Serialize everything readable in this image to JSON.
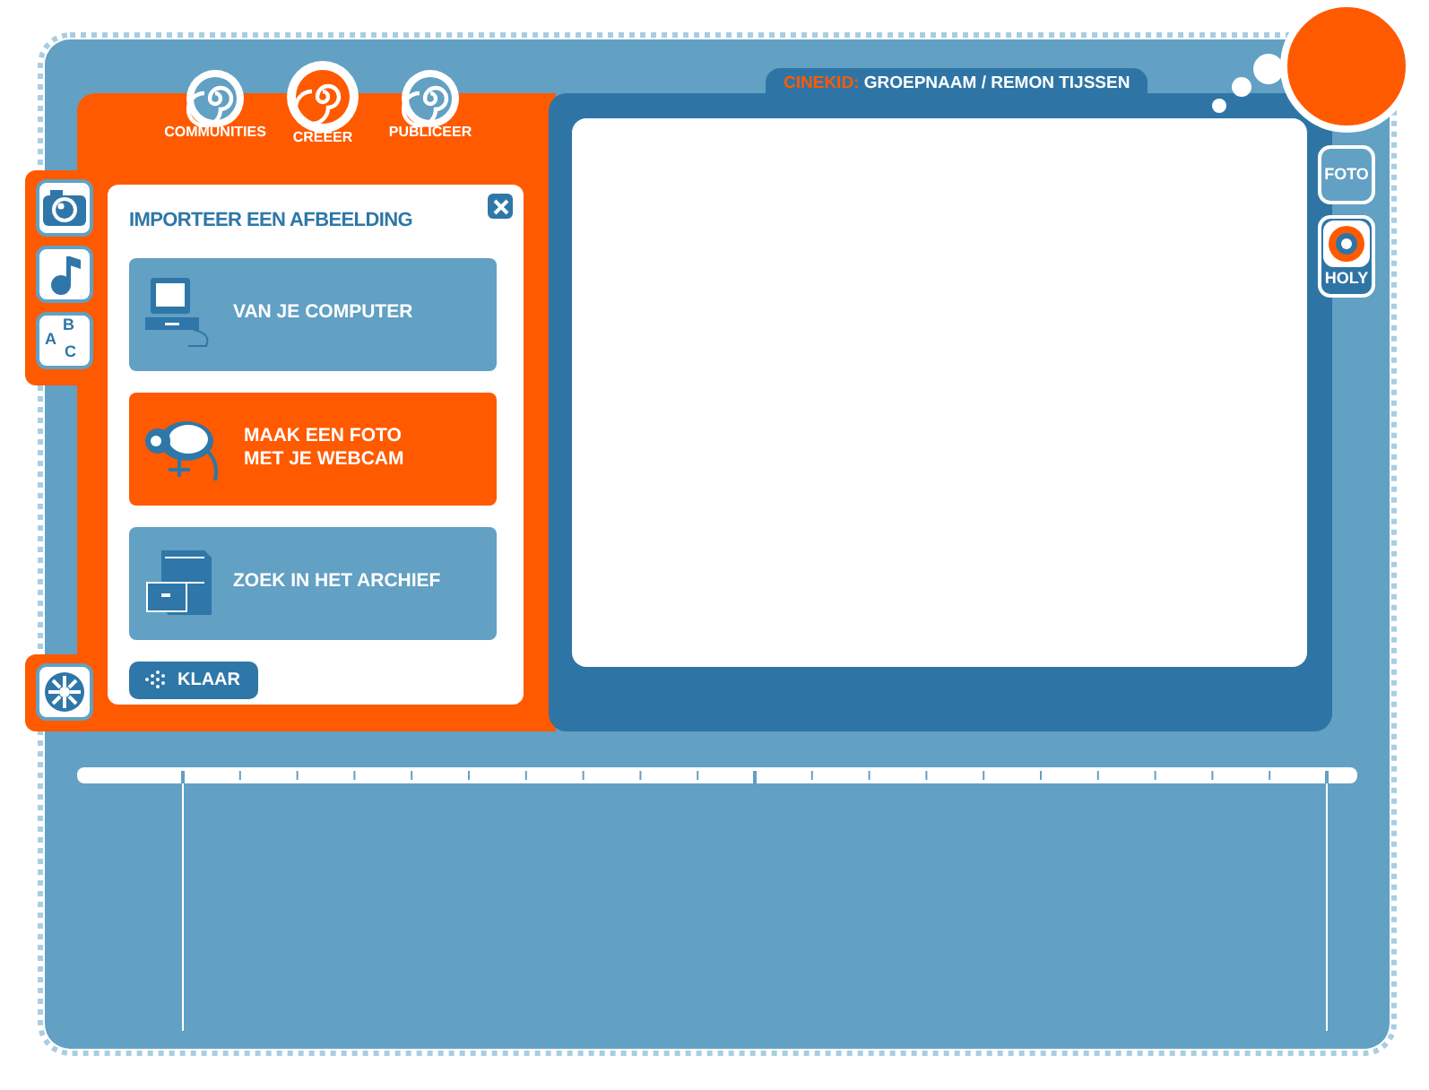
{
  "nav_tabs": [
    {
      "label": "COMMUNITIES",
      "selected": false
    },
    {
      "label": "CREËER",
      "selected": true
    },
    {
      "label": "PUBLICEER",
      "selected": false
    }
  ],
  "tool_tabs": [
    {
      "kind": "camera"
    },
    {
      "kind": "music"
    },
    {
      "kind": "letters",
      "letters": [
        "B",
        "A",
        "C"
      ]
    }
  ],
  "dialog": {
    "title": "IMPORTEER EEN AFBEELDING",
    "options": [
      {
        "kind": "computer",
        "label": "VAN JE COMPUTER",
        "selected": false
      },
      {
        "kind": "webcam",
        "label": "MAAK EEN FOTO\nMET JE WEBCAM",
        "selected": true
      },
      {
        "kind": "archive",
        "label": "ZOEK IN HET ARCHIEF",
        "selected": false
      }
    ],
    "done_button": "KLAAR"
  },
  "stage": {
    "brand": "CINEKID:",
    "title": "GROEPNAAM / REMON TIJSSEN"
  },
  "side_buttons": [
    {
      "kind": "text",
      "label": "FOTO"
    },
    {
      "kind": "logo",
      "label": "HOLY"
    }
  ]
}
